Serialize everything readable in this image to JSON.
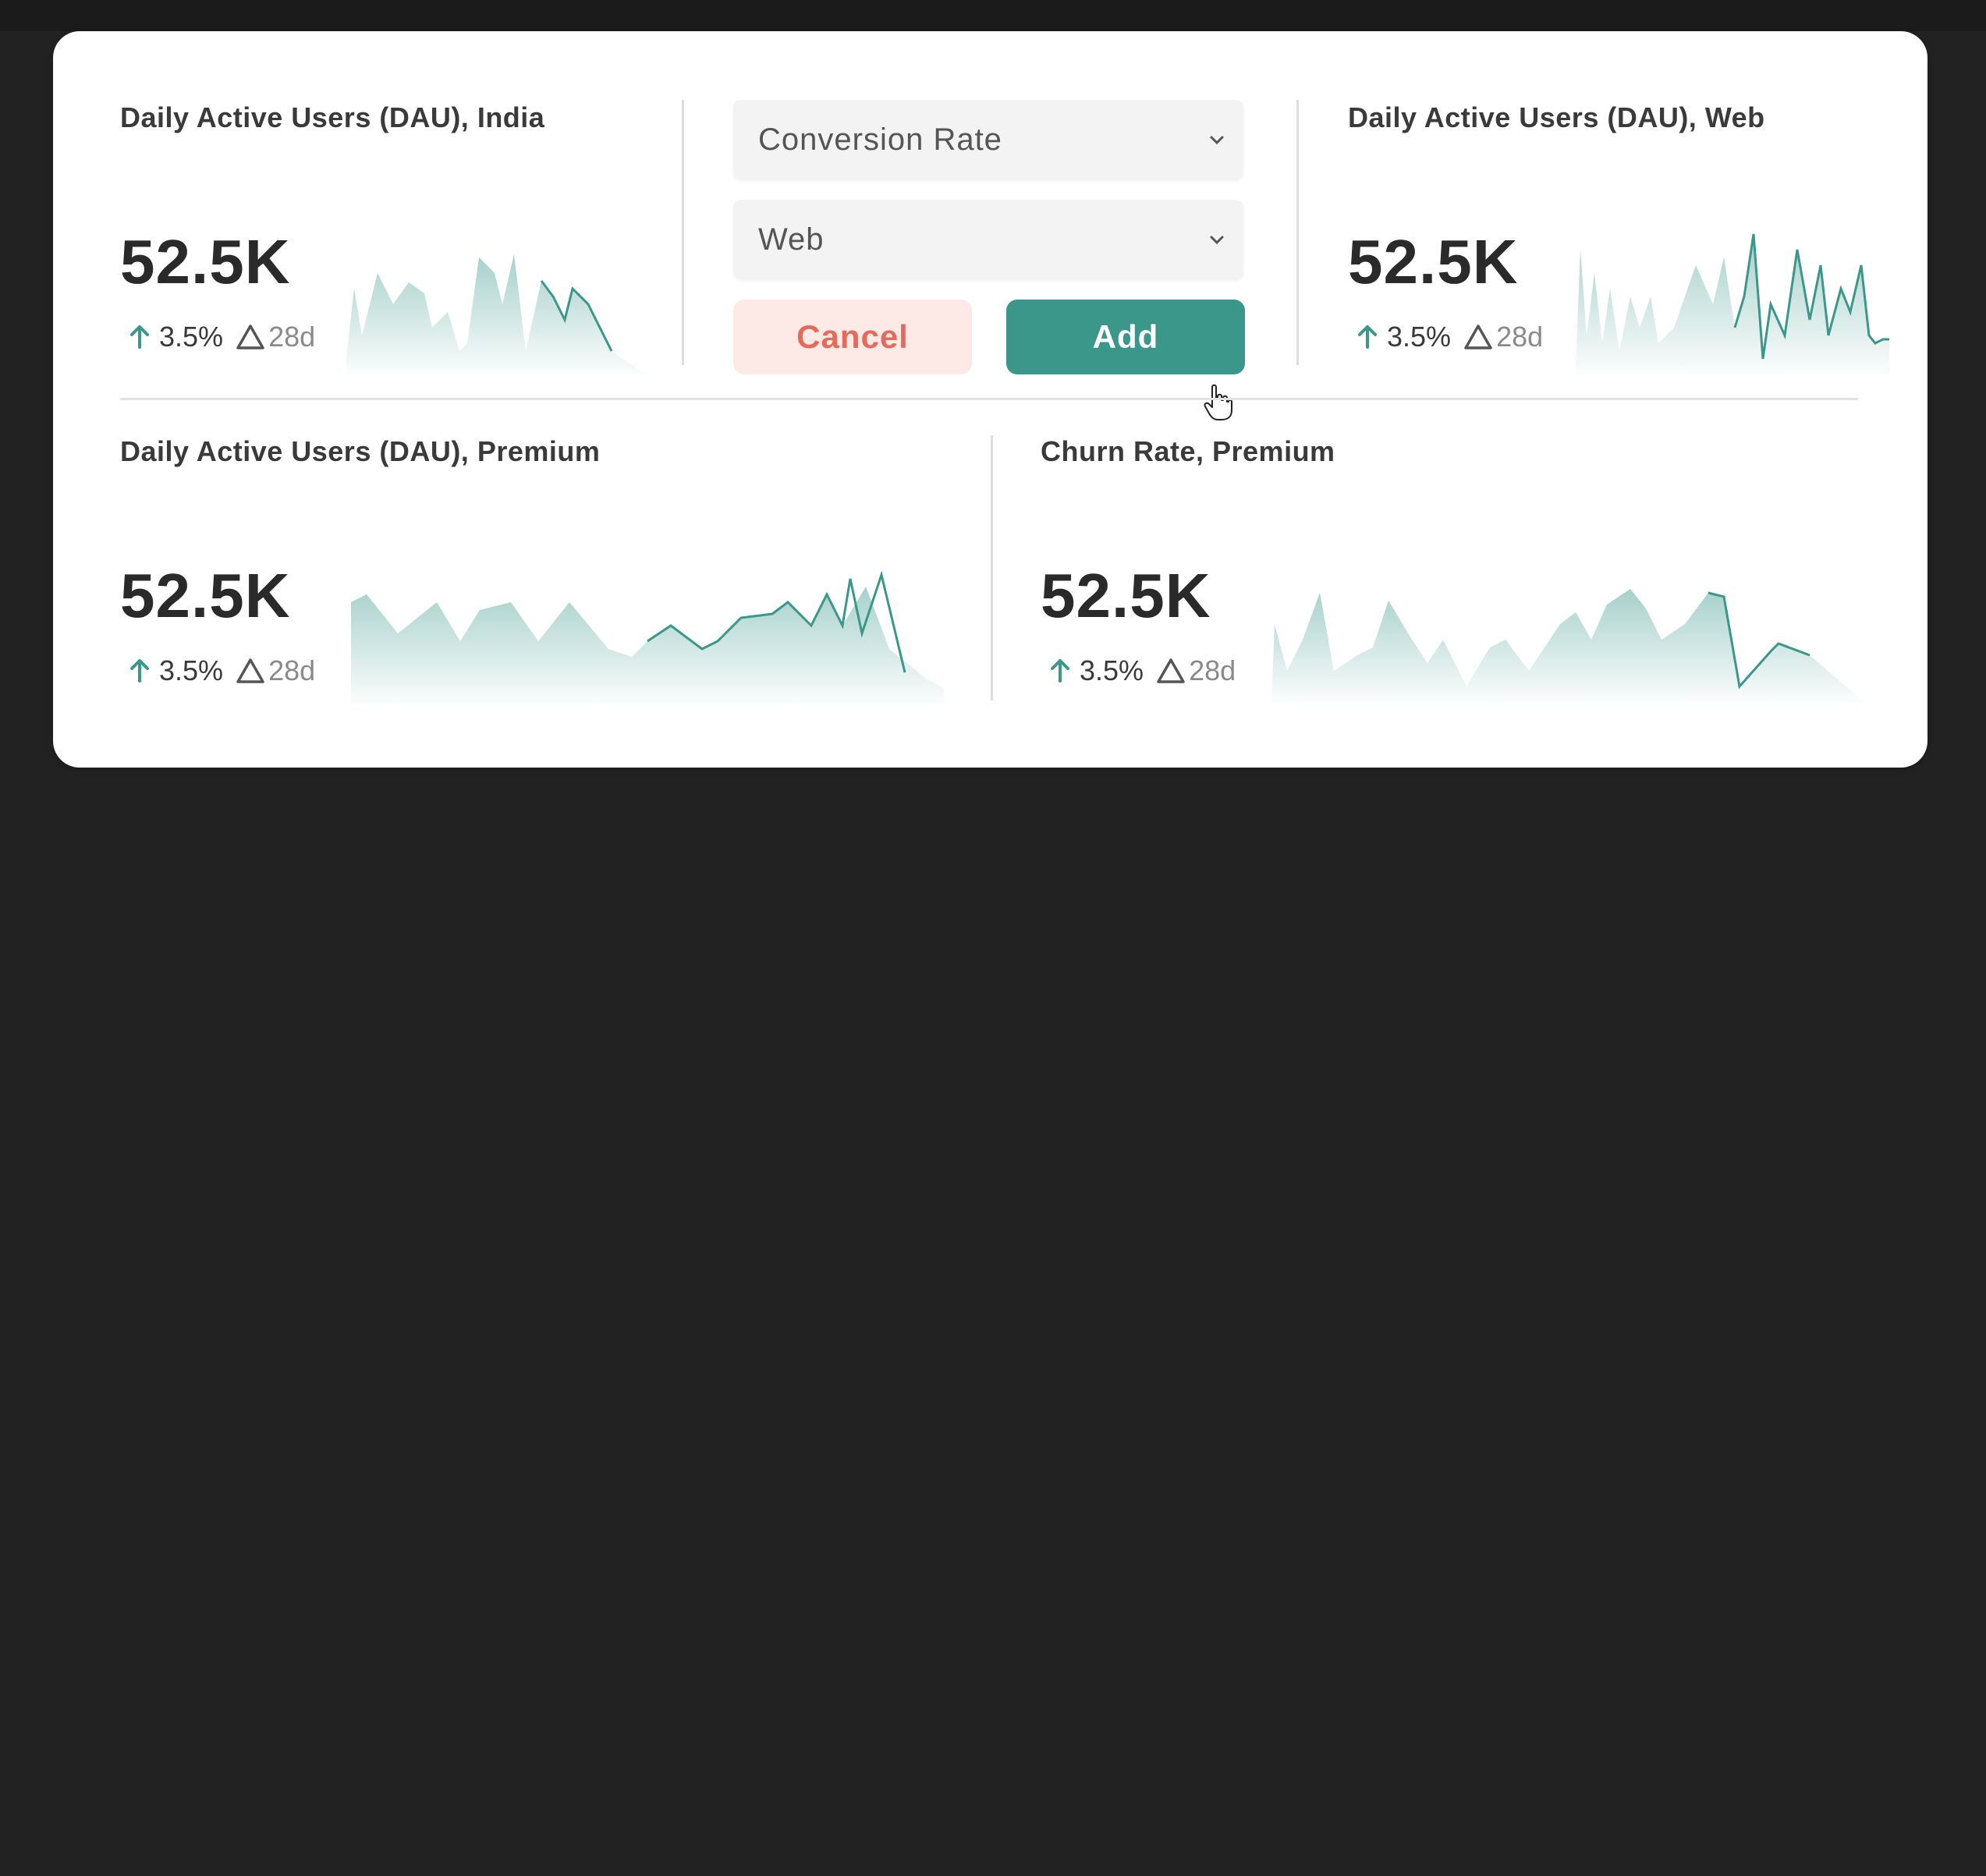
{
  "colors": {
    "accent": "#3a978a",
    "cancel_bg": "#fde9e6",
    "cancel_text": "#e46b5a"
  },
  "picker": {
    "metric_select": {
      "value": "Conversion Rate",
      "icon": "chevron-down-icon"
    },
    "segment_select": {
      "value": "Web",
      "icon": "chevron-down-icon"
    },
    "cancel_label": "Cancel",
    "add_label": "Add"
  },
  "metrics": [
    {
      "title": "Daily Active Users (DAU), India",
      "value": "52.5K",
      "delta_pct": "3.5%",
      "period": "28d"
    },
    {
      "title": "Daily Active Users (DAU), Web",
      "value": "52.5K",
      "delta_pct": "3.5%",
      "period": "28d"
    },
    {
      "title": "Daily Active Users (DAU), Premium",
      "value": "52.5K",
      "delta_pct": "3.5%",
      "period": "28d"
    },
    {
      "title": "Churn Rate, Premium",
      "value": "52.5K",
      "delta_pct": "3.5%",
      "period": "28d"
    }
  ],
  "icons": {
    "delta_up": "arrow-up-icon",
    "period": "triangle-delta-icon",
    "cursor": "hand-pointer-icon"
  }
}
